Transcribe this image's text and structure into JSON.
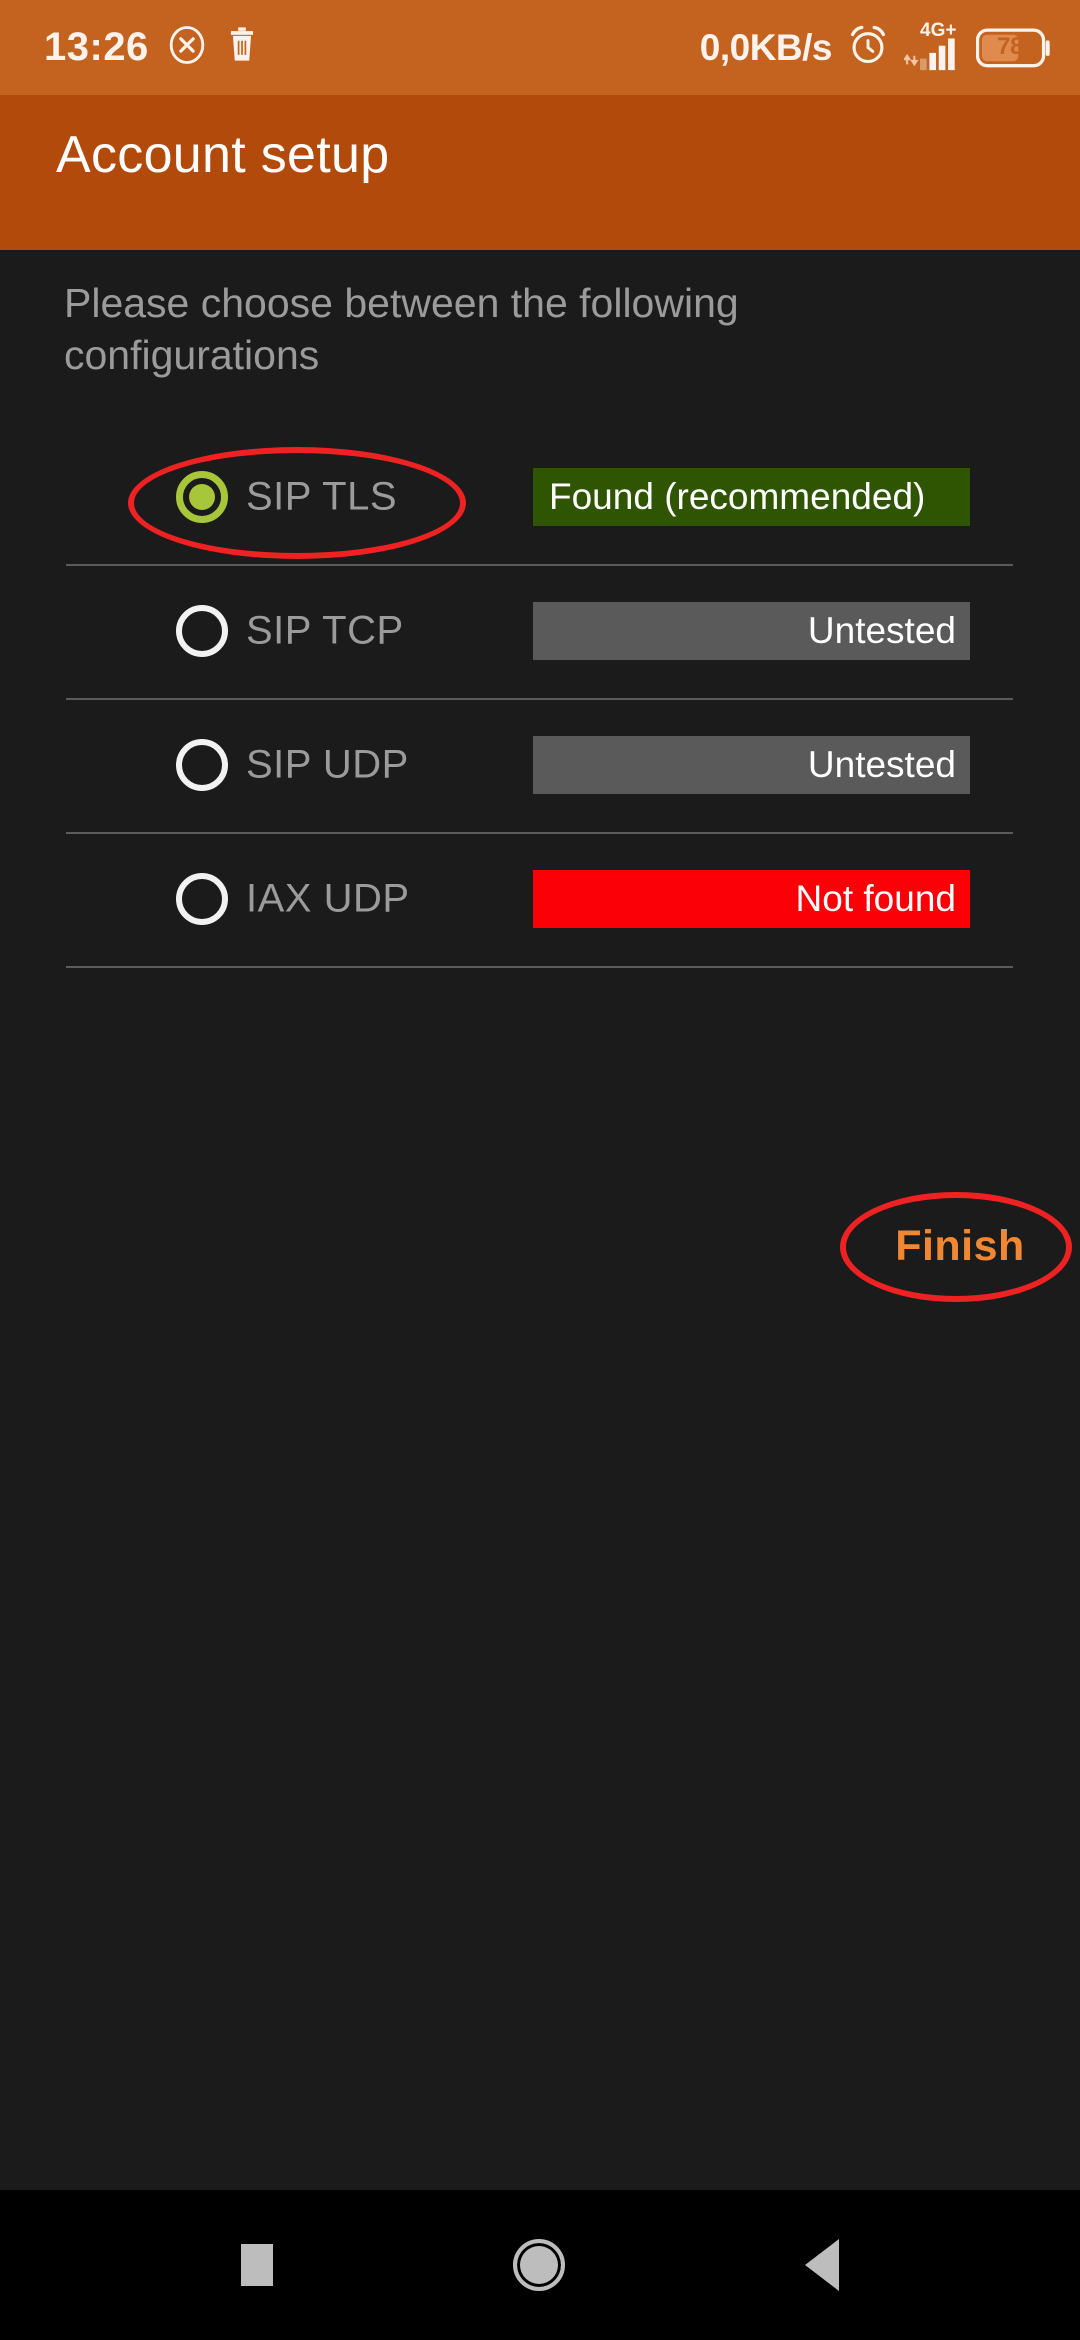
{
  "status_bar": {
    "clock": "13:26",
    "cancel_icon": "circle-x-icon",
    "trash_icon": "trash-icon",
    "network_speed": "0,0KB/s",
    "alarm_icon": "alarm-clock-icon",
    "network_type": "4G+",
    "signal_icon": "signal-bars-icon",
    "battery_level": "78",
    "background_color": "#c3631f"
  },
  "app_bar": {
    "title": "Account setup",
    "background_color": "#b24a0b",
    "title_color": "#ffffff"
  },
  "main": {
    "instructions": "Please choose between the following configurations",
    "options": [
      {
        "label": "SIP TLS",
        "selected": true,
        "status": "Found (recommended)",
        "status_kind": "found",
        "status_color": "#2f5503",
        "radio_color": "#a7c63a"
      },
      {
        "label": "SIP TCP",
        "selected": false,
        "status": "Untested",
        "status_kind": "untested",
        "status_color": "#5a5a5a",
        "radio_color": "#f2f2f2"
      },
      {
        "label": "SIP UDP",
        "selected": false,
        "status": "Untested",
        "status_kind": "untested",
        "status_color": "#5a5a5a",
        "radio_color": "#f2f2f2"
      },
      {
        "label": "IAX UDP",
        "selected": false,
        "status": "Not found",
        "status_kind": "notfound",
        "status_color": "#fb0007",
        "radio_color": "#f2f2f2"
      }
    ],
    "finish_label": "Finish",
    "finish_color": "#f08833",
    "annotation_color": "#ee2222"
  },
  "nav_bar": {
    "recents_icon": "square-recents-icon",
    "home_icon": "circle-home-icon",
    "back_icon": "triangle-back-icon"
  }
}
